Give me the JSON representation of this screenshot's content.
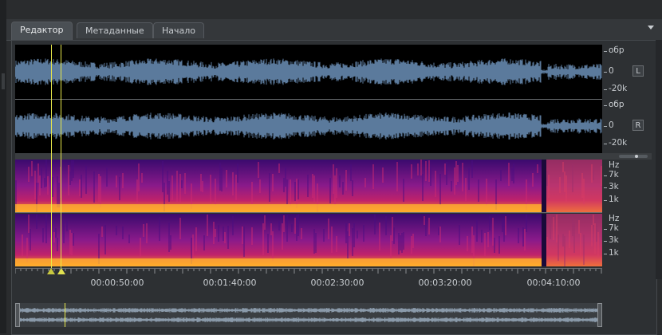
{
  "tabs": [
    {
      "label": "Редактор",
      "active": true
    },
    {
      "label": "Метаданные",
      "active": false
    },
    {
      "label": "Начало",
      "active": false
    }
  ],
  "waveform": {
    "left": {
      "labels": [
        "обр",
        "0",
        "-20k"
      ],
      "channel_button": "L"
    },
    "right": {
      "labels": [
        "обр",
        "0",
        "-20k"
      ],
      "channel_button": "R"
    }
  },
  "spectrogram": {
    "labels": [
      "Hz",
      "7k",
      "3k",
      "1k"
    ]
  },
  "timeline": {
    "labels": [
      "00:00:50:00",
      "00:01:40:00",
      "00:02:30:00",
      "00:03:20:00",
      "00:04:10:00"
    ]
  },
  "colors": {
    "wave": "#5b7a9c",
    "cursor": "#e8e84a",
    "spectrogram_low": "#3a0a6e",
    "spectrogram_mid": "#c0226a",
    "spectrogram_high": "#ff9a1a"
  }
}
